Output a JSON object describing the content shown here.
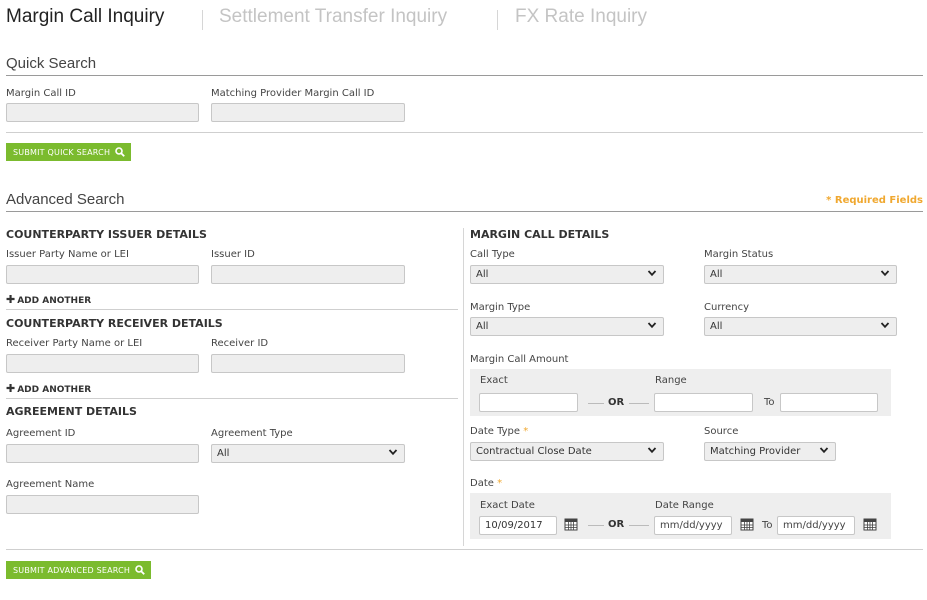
{
  "tabs": [
    {
      "label": "Margin Call Inquiry",
      "active": true
    },
    {
      "label": "Settlement Transfer Inquiry",
      "active": false
    },
    {
      "label": "FX Rate Inquiry",
      "active": false
    }
  ],
  "quick_search": {
    "title": "Quick Search",
    "margin_call_id_label": "Margin Call ID",
    "matching_provider_label": "Matching Provider Margin Call ID",
    "submit_label": "SUBMIT QUICK SEARCH"
  },
  "advanced_search": {
    "title": "Advanced Search",
    "required_note": "* Required Fields",
    "submit_label": "SUBMIT ADVANCED SEARCH"
  },
  "issuer": {
    "heading": "COUNTERPARTY ISSUER DETAILS",
    "party_label": "Issuer Party Name or LEI",
    "id_label": "Issuer ID",
    "add_another": "ADD ANOTHER"
  },
  "receiver": {
    "heading": "COUNTERPARTY RECEIVER DETAILS",
    "party_label": "Receiver Party Name or LEI",
    "id_label": "Receiver ID",
    "add_another": "ADD ANOTHER"
  },
  "agreement": {
    "heading": "AGREEMENT DETAILS",
    "id_label": "Agreement ID",
    "type_label": "Agreement Type",
    "type_value": "All",
    "name_label": "Agreement Name"
  },
  "margin_call": {
    "heading": "MARGIN CALL DETAILS",
    "call_type_label": "Call Type",
    "call_type_value": "All",
    "margin_status_label": "Margin Status",
    "margin_status_value": "All",
    "margin_type_label": "Margin Type",
    "margin_type_value": "All",
    "currency_label": "Currency",
    "currency_value": "All",
    "amount_label": "Margin Call Amount",
    "exact_label": "Exact",
    "or_label": "OR",
    "range_label": "Range",
    "to_label": "To",
    "date_type_label": "Date Type",
    "date_type_value": "Contractual Close Date",
    "source_label": "Source",
    "source_value": "Matching Provider",
    "date_label": "Date",
    "exact_date_label": "Exact Date",
    "exact_date_value": "10/09/2017",
    "date_range_label": "Date Range",
    "range_from_placeholder": "mm/dd/yyyy",
    "range_to_placeholder": "mm/dd/yyyy",
    "required_star": "*"
  },
  "icons": {
    "search": "search-icon",
    "calendar": "calendar-icon",
    "chevron": "chevron-down-icon",
    "plus": "plus-icon"
  },
  "colors": {
    "accent_green": "#7bbb2e",
    "required_orange": "#f0a830",
    "field_bg": "#eeeeee"
  }
}
